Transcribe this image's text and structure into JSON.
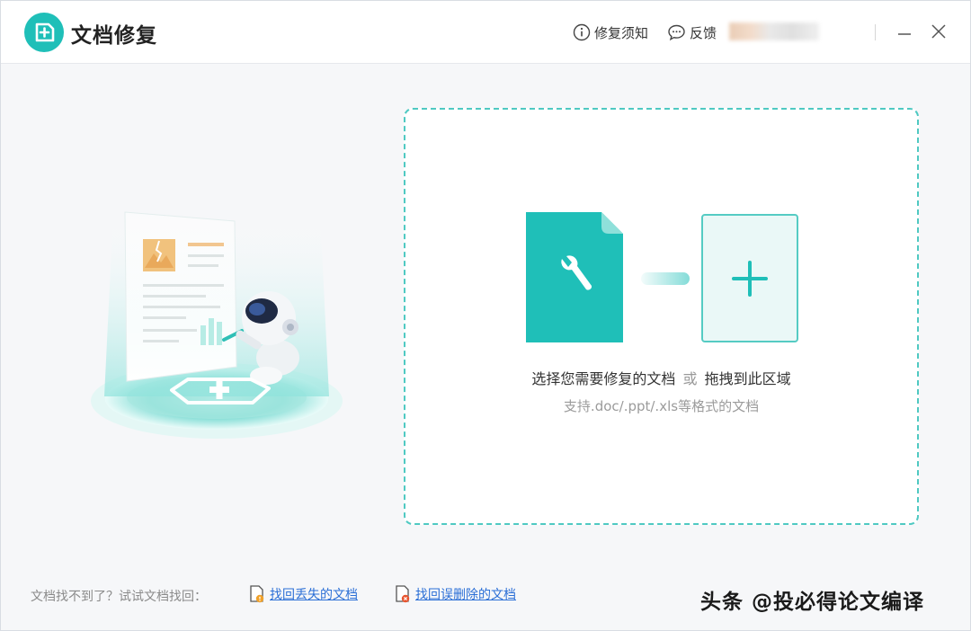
{
  "app": {
    "title": "文档修复",
    "brand_color": "#1fbfb8"
  },
  "titlebar": {
    "notice_label": "修复须知",
    "feedback_label": "反馈",
    "minimize_icon": "minimize-icon",
    "close_icon": "close-icon"
  },
  "dropzone": {
    "main_text_select": "选择您需要修复的文档",
    "main_text_or": "或",
    "main_text_drag": "拖拽到此区域",
    "sub_text": "支持.doc/.ppt/.xls等格式的文档",
    "border_color": "#4fc9c2",
    "file_icon": "wrench-file-icon",
    "add_icon": "plus-icon"
  },
  "footer": {
    "hint": "文档找不到了？试试文档找回：",
    "lost_link": "找回丢失的文档",
    "deleted_link": "找回误删除的文档",
    "link_color": "#2b6fd6"
  },
  "watermark": "头条 @投必得论文编译"
}
